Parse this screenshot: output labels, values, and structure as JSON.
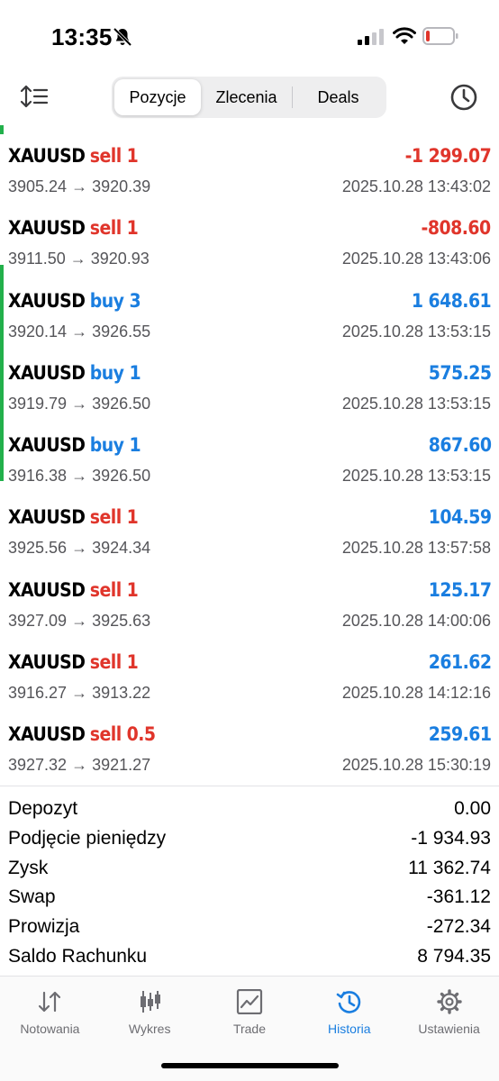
{
  "status_bar": {
    "time": "13:35"
  },
  "toolbar": {
    "tabs": [
      {
        "label": "Pozycje",
        "active": true
      },
      {
        "label": "Zlecenia",
        "active": false
      },
      {
        "label": "Deals",
        "active": false
      }
    ]
  },
  "trades": [
    {
      "symbol": "XAUUSD",
      "side": "sell 1",
      "profit": "-1 299.07",
      "prices": "3905.24 → 3920.39",
      "time": "2025.10.28 13:43:02"
    },
    {
      "symbol": "XAUUSD",
      "side": "sell 1",
      "profit": "-808.60",
      "prices": "3911.50 → 3920.93",
      "time": "2025.10.28 13:43:06"
    },
    {
      "symbol": "XAUUSD",
      "side": "buy 3",
      "profit": "1 648.61",
      "prices": "3920.14 → 3926.55",
      "time": "2025.10.28 13:53:15"
    },
    {
      "symbol": "XAUUSD",
      "side": "buy 1",
      "profit": "575.25",
      "prices": "3919.79 → 3926.50",
      "time": "2025.10.28 13:53:15"
    },
    {
      "symbol": "XAUUSD",
      "side": "buy 1",
      "profit": "867.60",
      "prices": "3916.38 → 3926.50",
      "time": "2025.10.28 13:53:15"
    },
    {
      "symbol": "XAUUSD",
      "side": "sell 1",
      "profit": "104.59",
      "prices": "3925.56 → 3924.34",
      "time": "2025.10.28 13:57:58"
    },
    {
      "symbol": "XAUUSD",
      "side": "sell 1",
      "profit": "125.17",
      "prices": "3927.09 → 3925.63",
      "time": "2025.10.28 14:00:06"
    },
    {
      "symbol": "XAUUSD",
      "side": "sell 1",
      "profit": "261.62",
      "prices": "3916.27 → 3913.22",
      "time": "2025.10.28 14:12:16"
    },
    {
      "symbol": "XAUUSD",
      "side": "sell 0.5",
      "profit": "259.61",
      "prices": "3927.32 → 3921.27",
      "time": "2025.10.28 15:30:19"
    }
  ],
  "summary": [
    {
      "label": "Depozyt",
      "value": "0.00"
    },
    {
      "label": "Podjęcie pieniędzy",
      "value": "-1 934.93"
    },
    {
      "label": "Zysk",
      "value": "11 362.74"
    },
    {
      "label": "Swap",
      "value": "-361.12"
    },
    {
      "label": "Prowizja",
      "value": "-272.34"
    },
    {
      "label": "Saldo Rachunku",
      "value": "8 794.35"
    }
  ],
  "tab_bar": [
    {
      "label": "Notowania",
      "icon": "quotes-arrows-icon",
      "active": false
    },
    {
      "label": "Wykres",
      "icon": "candlestick-chart-icon",
      "active": false
    },
    {
      "label": "Trade",
      "icon": "trade-chart-icon",
      "active": false
    },
    {
      "label": "Historia",
      "icon": "history-clock-icon",
      "active": true
    },
    {
      "label": "Ustawienia",
      "icon": "gear-icon",
      "active": false
    }
  ],
  "colors": {
    "sell": "#e0352b",
    "buy": "#1a7ee0",
    "profit_positive": "#1a7ee0",
    "profit_negative": "#e0352b",
    "accent": "#1a7ee0",
    "marker": "#22b04b"
  }
}
